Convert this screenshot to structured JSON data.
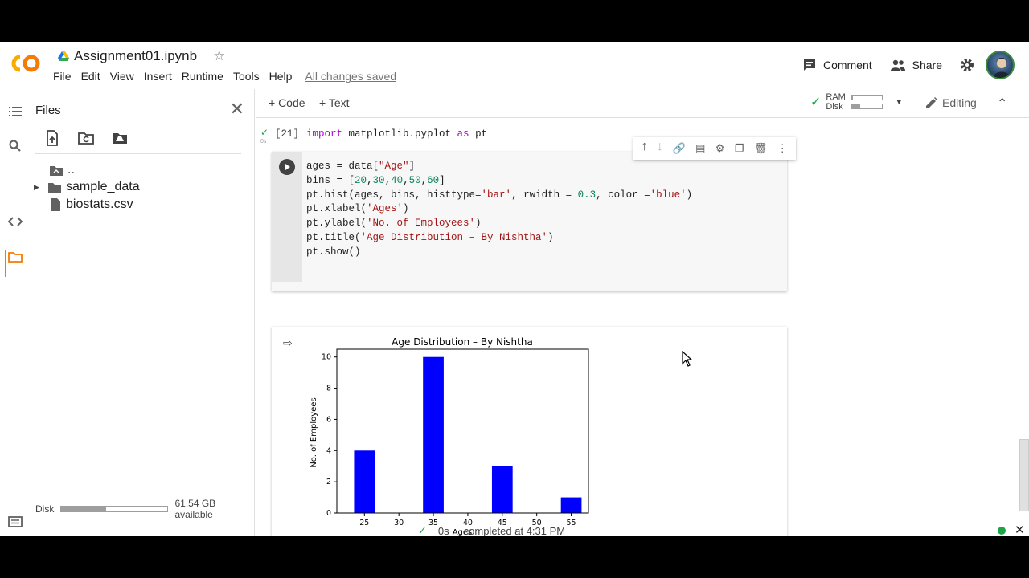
{
  "header": {
    "logo_text": "CO",
    "doc_title": "Assignment01.ipynb",
    "menu": [
      "File",
      "Edit",
      "View",
      "Insert",
      "Runtime",
      "Tools",
      "Help"
    ],
    "saved_status": "All changes saved",
    "comment_label": "Comment",
    "share_label": "Share"
  },
  "files_panel": {
    "title": "Files",
    "tree": [
      {
        "label": "..",
        "type": "parent-folder"
      },
      {
        "label": "sample_data",
        "type": "folder"
      },
      {
        "label": "biostats.csv",
        "type": "file"
      }
    ],
    "disk_label": "Disk",
    "disk_available": "61.54 GB available",
    "disk_used_fraction": 0.42
  },
  "toolbar": {
    "code_label": "+ Code",
    "text_label": "+ Text",
    "ram_label": "RAM",
    "disk_label": "Disk",
    "ram_used_fraction": 0.05,
    "disk_used_fraction": 0.3,
    "editing_label": "Editing"
  },
  "cells": {
    "cell1_prompt": "[21]",
    "cell1_elapsed": "0s",
    "cell2_lines_count": 7
  },
  "status": {
    "elapsed": "0s",
    "completed": "completed at 4:31 PM"
  },
  "colors": {
    "accent_orange": "#f9ab00",
    "bar_blue": "#0000ff",
    "ok_green": "#1ea446"
  },
  "chart_data": {
    "type": "bar",
    "title": "Age Distribution – By Nishtha",
    "xlabel": "Ages",
    "ylabel": "No. of Employees",
    "x_ticks": [
      25,
      30,
      35,
      40,
      45,
      50,
      55
    ],
    "y_ticks": [
      0,
      2,
      4,
      6,
      8,
      10
    ],
    "xlim": [
      21,
      57.5
    ],
    "ylim": [
      0,
      10.5
    ],
    "bars": [
      {
        "center": 25,
        "width": 3,
        "value": 4
      },
      {
        "center": 35,
        "width": 3,
        "value": 10
      },
      {
        "center": 45,
        "width": 3,
        "value": 3
      },
      {
        "center": 55,
        "width": 3,
        "value": 1
      }
    ],
    "color": "#0000ff"
  }
}
